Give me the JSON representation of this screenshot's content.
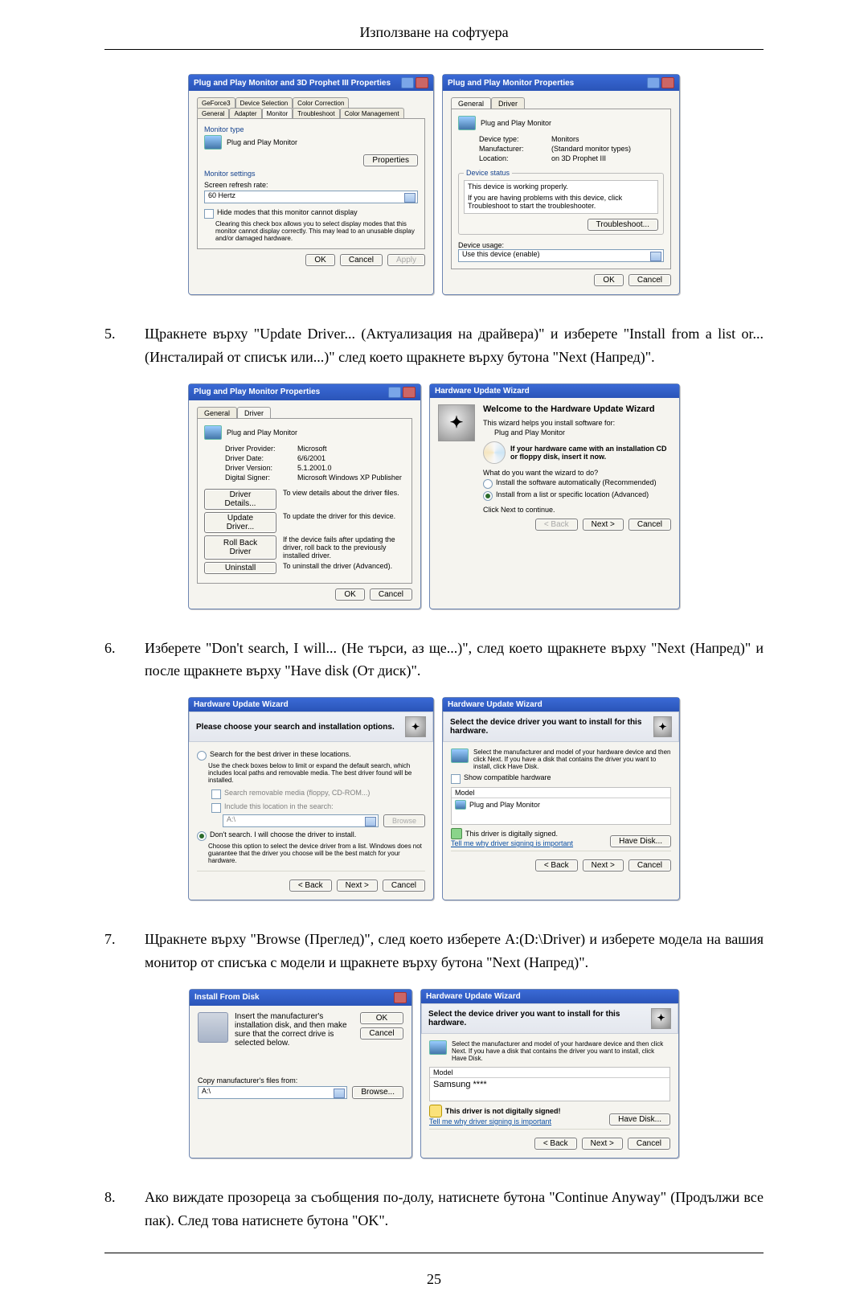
{
  "page": {
    "header": "Използване на софтуера",
    "number": "25"
  },
  "steps": {
    "s5": {
      "num": "5.",
      "text": "Щракнете върху \"Update Driver... (Актуализация на драйвера)\" и изберете \"Install from a list or... (Инсталирай от списък или...)\" след което щракнете върху бутона \"Next (Напред)\"."
    },
    "s6": {
      "num": "6.",
      "text": "Изберете \"Don't search, I will... (Не търси, аз ще...)\", след което щракнете върху \"Next (Напред)\" и после щракнете върху \"Have disk (От диск)\"."
    },
    "s7": {
      "num": "7.",
      "text": "Щракнете върху \"Browse (Преглед)\", след което изберете A:(D:\\Driver) и изберете модела на вашия монитор от списъка с модели и щракнете върху бутона \"Next (Напред)\"."
    },
    "s8": {
      "num": "8.",
      "text": "Ако виждате прозореца за съобщения по-долу, натиснете бутона \"Continue Anyway\" (Продължи все пак). След това натиснете бутона \"OK\"."
    }
  },
  "dlg1": {
    "title": "Plug and Play Monitor and 3D Prophet III Properties",
    "tabs": [
      "GeForce3",
      "Device Selection",
      "Color Correction",
      "General",
      "Adapter",
      "Monitor",
      "Troubleshoot",
      "Color Management"
    ],
    "monitorType": "Monitor type",
    "monitorName": "Plug and Play Monitor",
    "propertiesBtn": "Properties",
    "monitorSettings": "Monitor settings",
    "refreshLabel": "Screen refresh rate:",
    "refreshValue": "60 Hertz",
    "hideModes": "Hide modes that this monitor cannot display",
    "hideDesc": "Clearing this check box allows you to select display modes that this monitor cannot display correctly. This may lead to an unusable display and/or damaged hardware.",
    "ok": "OK",
    "cancel": "Cancel",
    "apply": "Apply"
  },
  "dlg2": {
    "title": "Plug and Play Monitor Properties",
    "tabGeneral": "General",
    "tabDriver": "Driver",
    "deviceName": "Plug and Play Monitor",
    "devTypeK": "Device type:",
    "devTypeV": "Monitors",
    "mfrK": "Manufacturer:",
    "mfrV": "(Standard monitor types)",
    "locK": "Location:",
    "locV": "on 3D Prophet III",
    "statusLegend": "Device status",
    "statusLine": "This device is working properly.",
    "statusHelp": "If you are having problems with this device, click Troubleshoot to start the troubleshooter.",
    "troubleshoot": "Troubleshoot...",
    "usageLabel": "Device usage:",
    "usageValue": "Use this device (enable)",
    "ok": "OK",
    "cancel": "Cancel"
  },
  "dlg3": {
    "title": "Plug and Play Monitor Properties",
    "tabGeneral": "General",
    "tabDriver": "Driver",
    "deviceName": "Plug and Play Monitor",
    "provK": "Driver Provider:",
    "provV": "Microsoft",
    "dateK": "Driver Date:",
    "dateV": "6/6/2001",
    "verK": "Driver Version:",
    "verV": "5.1.2001.0",
    "sigK": "Digital Signer:",
    "sigV": "Microsoft Windows XP Publisher",
    "detailsBtn": "Driver Details...",
    "detailsDesc": "To view details about the driver files.",
    "updateBtn": "Update Driver...",
    "updateDesc": "To update the driver for this device.",
    "rollbackBtn": "Roll Back Driver",
    "rollbackDesc": "If the device fails after updating the driver, roll back to the previously installed driver.",
    "uninstallBtn": "Uninstall",
    "uninstallDesc": "To uninstall the driver (Advanced).",
    "ok": "OK",
    "cancel": "Cancel"
  },
  "dlg4": {
    "title": "Hardware Update Wizard",
    "welcome": "Welcome to the Hardware Update Wizard",
    "intro": "This wizard helps you install software for:",
    "device": "Plug and Play Monitor",
    "cdHint": "If your hardware came with an installation CD or floppy disk, insert it now.",
    "question": "What do you want the wizard to do?",
    "opt1": "Install the software automatically (Recommended)",
    "opt2": "Install from a list or specific location (Advanced)",
    "clickNext": "Click Next to continue.",
    "back": "< Back",
    "next": "Next >",
    "cancel": "Cancel"
  },
  "dlg5": {
    "title": "Hardware Update Wizard",
    "banner": "Please choose your search and installation options.",
    "opt1": "Search for the best driver in these locations.",
    "opt1desc": "Use the check boxes below to limit or expand the default search, which includes local paths and removable media. The best driver found will be installed.",
    "chk1": "Search removable media (floppy, CD-ROM...)",
    "chk2": "Include this location in the search:",
    "pathValue": "A:\\",
    "browse": "Browse",
    "opt2": "Don't search. I will choose the driver to install.",
    "opt2desc": "Choose this option to select the device driver from a list. Windows does not guarantee that the driver you choose will be the best match for your hardware.",
    "back": "< Back",
    "next": "Next >",
    "cancel": "Cancel"
  },
  "dlg6": {
    "title": "Hardware Update Wizard",
    "banner": "Select the device driver you want to install for this hardware.",
    "desc": "Select the manufacturer and model of your hardware device and then click Next. If you have a disk that contains the driver you want to install, click Have Disk.",
    "showCompat": "Show compatible hardware",
    "modelHdr": "Model",
    "modelItem": "Plug and Play Monitor",
    "signed": "This driver is digitally signed.",
    "tellWhy": "Tell me why driver signing is important",
    "haveDisk": "Have Disk...",
    "back": "< Back",
    "next": "Next >",
    "cancel": "Cancel"
  },
  "dlg7": {
    "title": "Install From Disk",
    "instr": "Insert the manufacturer's installation disk, and then make sure that the correct drive is selected below.",
    "ok": "OK",
    "cancel": "Cancel",
    "copyFrom": "Copy manufacturer's files from:",
    "pathValue": "A:\\",
    "browse": "Browse..."
  },
  "dlg8": {
    "title": "Hardware Update Wizard",
    "banner": "Select the device driver you want to install for this hardware.",
    "desc": "Select the manufacturer and model of your hardware device and then click Next. If you have a disk that contains the driver you want to install, click Have Disk.",
    "modelHdr": "Model",
    "modelItem": "Samsung ****",
    "notSigned": "This driver is not digitally signed!",
    "tellWhy": "Tell me why driver signing is important",
    "haveDisk": "Have Disk...",
    "back": "< Back",
    "next": "Next >",
    "cancel": "Cancel"
  }
}
